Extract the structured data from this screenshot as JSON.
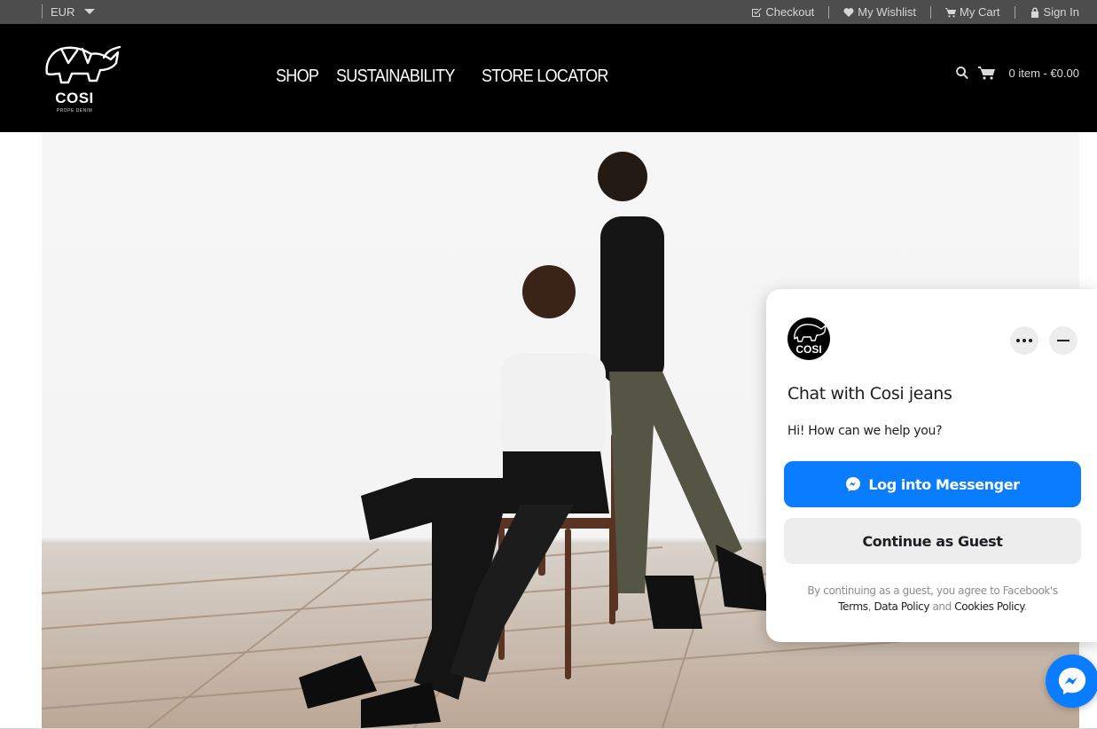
{
  "topbar": {
    "currency": "EUR",
    "links": [
      {
        "label": "Checkout",
        "icon": "checkbox-icon"
      },
      {
        "label": "My Wishlist",
        "icon": "heart-icon"
      },
      {
        "label": "My Cart",
        "icon": "cart-icon"
      },
      {
        "label": "Sign In",
        "icon": "lock-icon"
      }
    ]
  },
  "header": {
    "logo_text": "COSI",
    "logo_tagline": "PROPE DENIM",
    "nav": [
      "SHOP",
      "SUSTAINABILITY",
      "STORE LOCATOR"
    ],
    "cart_summary": "0 item - €0.00"
  },
  "chat": {
    "avatar_text": "COSI",
    "title": "Chat with Cosi jeans",
    "greeting": "Hi! How can we help you?",
    "messenger_button": "Log into Messenger",
    "guest_button": "Continue as Guest",
    "legal_prefix": "By continuing as a guest, you agree to Facebook's",
    "terms": "Terms",
    "data_policy": "Data Policy",
    "and": "and",
    "cookies_policy": "Cookies Policy"
  },
  "colors": {
    "topbar_bg": "#4d4d4d",
    "header_bg": "#000000",
    "messenger_blue": "#0a7cff"
  }
}
